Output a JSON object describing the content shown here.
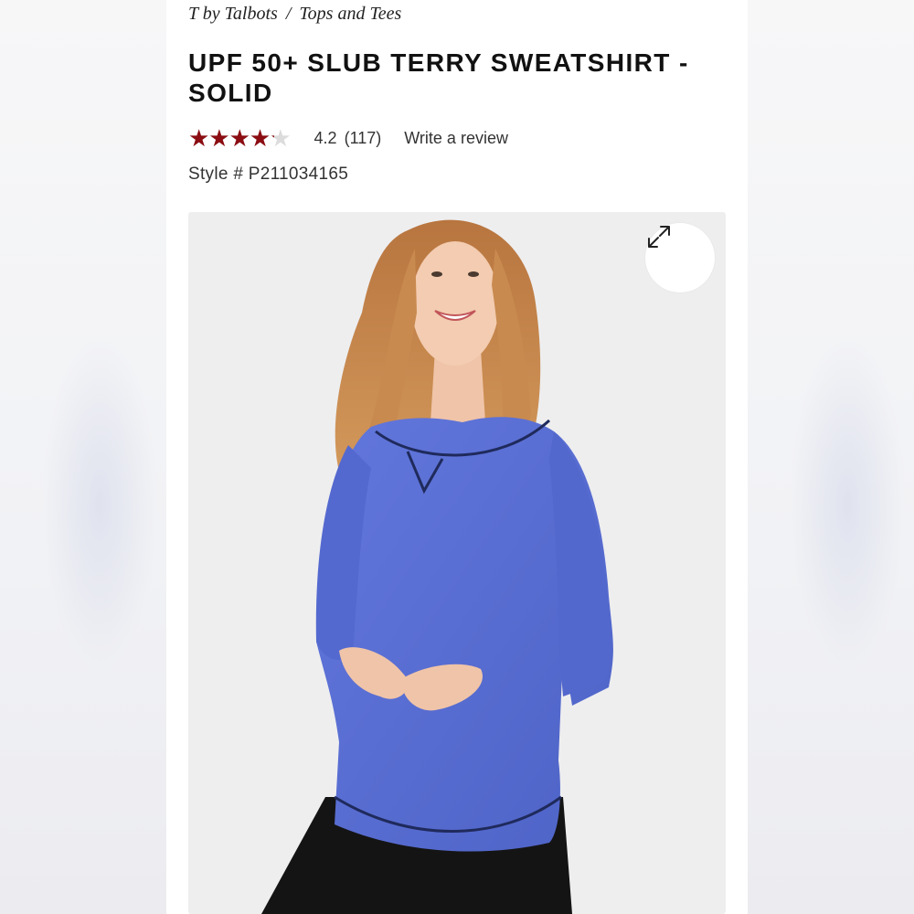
{
  "breadcrumb": {
    "items": [
      "T by Talbots",
      "Tops and Tees"
    ],
    "separator": "/"
  },
  "product": {
    "title": "UPF 50+ Slub Terry Sweatshirt - Solid",
    "rating": {
      "value": "4.2",
      "count": "(117)",
      "stars_filled_fraction": 0.84,
      "star_color": "#8b0d12",
      "empty_star_color": "#dcdcdc"
    },
    "write_review_label": "Write a review",
    "style_number": "Style # P211034165"
  },
  "image": {
    "icon": "expand-icon",
    "garment_color": "#5a6fd3"
  }
}
